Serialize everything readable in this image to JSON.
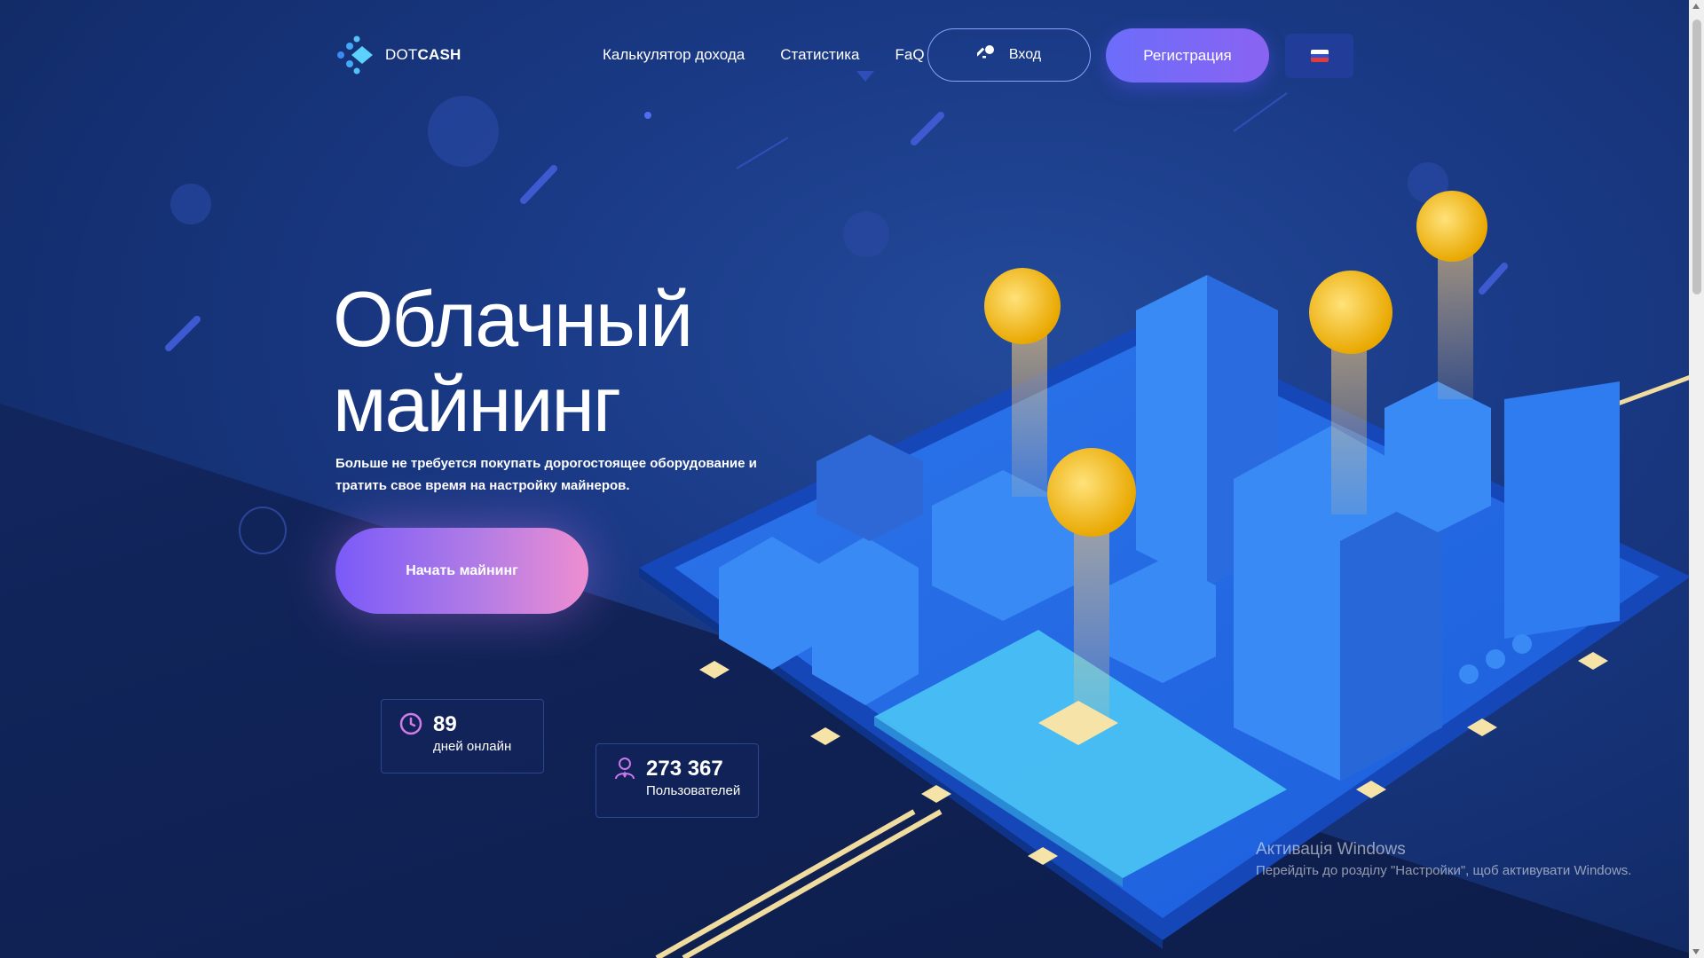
{
  "header": {
    "logo_prefix": "DOT",
    "logo_suffix": "CASH",
    "nav": [
      "Калькулятор дохода",
      "Статистика",
      "FaQ"
    ],
    "login_label": "Вход",
    "register_label": "Регистрация",
    "language": "RU"
  },
  "hero": {
    "title_line1": "Облачный",
    "title_line2": "майнинг",
    "subtitle": "Больше не требуется покупать дорогостоящее оборудование и тратить свое время на настройку майнеров.",
    "cta_label": "Начать майнинг"
  },
  "stats": [
    {
      "value": "89",
      "label": "дней онлайн",
      "icon": "clock-icon"
    },
    {
      "value": "273 367",
      "label": "Пользователей",
      "icon": "user-icon"
    }
  ],
  "watermark": {
    "title": "Активація Windows",
    "subtitle": "Перейдіть до розділу \"Настройки\", щоб активувати Windows."
  },
  "colors": {
    "accent": "#6c6dfa",
    "cta_start": "#7a5af8",
    "cta_end": "#ee8ed1",
    "background": "#1a3a86",
    "coin": "#f5c22b"
  }
}
